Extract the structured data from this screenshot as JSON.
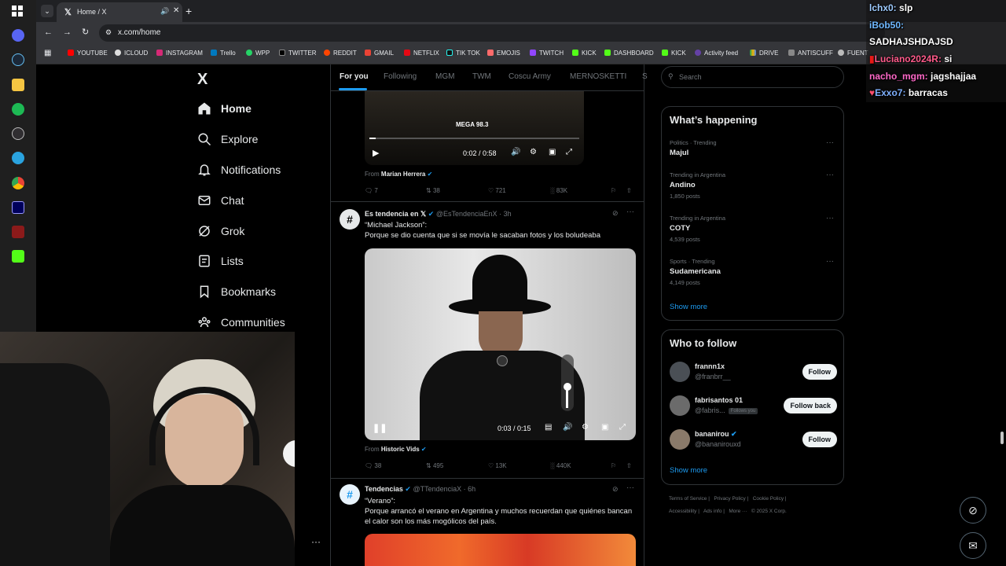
{
  "browser": {
    "tab_title": "Home / X",
    "url": "x.com/home",
    "bookmarks": [
      "YOUTUBE",
      "ICLOUD",
      "INSTAGRAM",
      "Trello",
      "WPP",
      "TWITTER",
      "REDDIT",
      "GMAIL",
      "NETFLIX",
      "TIK TOK",
      "EMOJIS",
      "TWITCH",
      "KICK",
      "DASHBOARD",
      "KICK",
      "Activity feed",
      "DRIVE",
      "ANTISCUFF",
      "FUENT"
    ]
  },
  "colors": {
    "accent": "#1d9bf0",
    "background": "#000000",
    "border": "#2f3336"
  },
  "nav": {
    "logo": "X",
    "items": [
      "Home",
      "Explore",
      "Notifications",
      "Chat",
      "Grok",
      "Lists",
      "Bookmarks",
      "Communities"
    ]
  },
  "feed": {
    "tabs": [
      "For you",
      "Following",
      "MGM",
      "TWM",
      "Coscu Army",
      "MERNOSKETTI",
      "S"
    ],
    "post1": {
      "video_time": "0:02 / 0:58",
      "video_logo": "MEGA 98.3",
      "from_label": "From",
      "from_name": "Marian Herrera",
      "replies": "7",
      "reposts": "38",
      "likes": "721",
      "views": "83K"
    },
    "post2": {
      "name": "Es tendencia en 𝕏",
      "handle": "@EsTendenciaEnX",
      "time": "3h",
      "line1": "“Michael Jackson”:",
      "line2": "Porque se dio cuenta que si se movía le sacaban fotos y los boludeaba",
      "video_time": "0:03 / 0:15",
      "from_label": "From",
      "from_name": "Historic Vids",
      "replies": "38",
      "reposts": "495",
      "likes": "13K",
      "views": "440K"
    },
    "post3": {
      "name": "Tendencias",
      "handle": "@TTendenciaX",
      "time": "6h",
      "line1": "“Verano”:",
      "line2": "Porque arrancó el verano en Argentina y muchos recuerdan que quiénes bancan el calor son los más mogólicos del país."
    }
  },
  "sidebar": {
    "search_placeholder": "Search",
    "happening_title": "What’s happening",
    "trends": [
      {
        "context": "Politics · Trending",
        "name": "Majul",
        "posts": ""
      },
      {
        "context": "Trending in Argentina",
        "name": "Andino",
        "posts": "1,850 posts"
      },
      {
        "context": "Trending in Argentina",
        "name": "COTY",
        "posts": "4,539 posts"
      },
      {
        "context": "Sports · Trending",
        "name": "Sudamericana",
        "posts": "4,149 posts"
      }
    ],
    "show_more": "Show more",
    "wtf_title": "Who to follow",
    "who_to_follow": [
      {
        "name": "frannn1x",
        "handle": "@franbrr__",
        "button": "Follow",
        "follows_you": ""
      },
      {
        "name": "fabrisantos 01",
        "handle": "@fabris...",
        "button": "Follow back",
        "follows_you": "Follows you"
      },
      {
        "name": "bananirou",
        "handle": "@bananirouxd",
        "button": "Follow",
        "follows_you": ""
      }
    ],
    "footer": [
      "Terms of Service",
      "Privacy Policy",
      "Cookie Policy",
      "Accessibility",
      "Ads info",
      "More ···",
      "© 2025 X Corp."
    ]
  },
  "chat": [
    {
      "user": "lchx0:",
      "msg": "slp"
    },
    {
      "user": "iBob50:",
      "msg": ""
    },
    {
      "user": "SADHAJSHDAJSD",
      "msg": ""
    },
    {
      "user": "Luciano2024R:",
      "msg": "si"
    },
    {
      "user": "nacho_mgm:",
      "msg": "jagshajjaa"
    },
    {
      "user": "Exxo7:",
      "msg": "barracas"
    }
  ]
}
